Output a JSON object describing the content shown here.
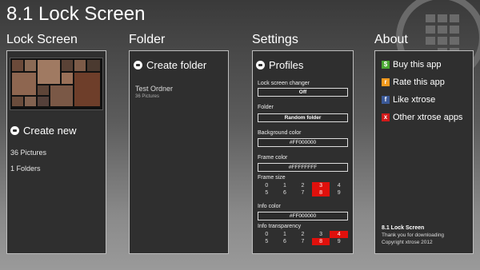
{
  "app": {
    "title": "8.1 Lock Screen"
  },
  "columns": {
    "lock": "Lock Screen",
    "folder": "Folder",
    "settings": "Settings",
    "about": "About"
  },
  "lock": {
    "create_label": "Create new",
    "pictures": "36 Pictures",
    "folders": "1 Folders"
  },
  "folder": {
    "create_label": "Create folder",
    "items": [
      {
        "name": "Test Ordner",
        "count": "36 Pictures"
      }
    ]
  },
  "settings": {
    "profiles_label": "Profiles",
    "changer_label": "Lock screen changer",
    "changer_value": "Off",
    "folder_label": "Folder",
    "folder_value": "Random folder",
    "bg_label": "Background color",
    "bg_value": "#FF000000",
    "frame_label": "Frame color",
    "frame_value": "#FFFFFFFF",
    "frame_size_label": "Frame size",
    "frame_size_options": [
      "0",
      "1",
      "2",
      "3",
      "4",
      "5",
      "6",
      "7",
      "8",
      "9"
    ],
    "frame_size_selected": [
      "3",
      "8"
    ],
    "info_label": "Info color",
    "info_value": "#FF000000",
    "transp_label": "Info transparency",
    "transp_options": [
      "0",
      "1",
      "2",
      "3",
      "4",
      "5",
      "6",
      "7",
      "8",
      "9"
    ],
    "transp_selected": [
      "4",
      "8"
    ]
  },
  "about": {
    "links": [
      {
        "label": "Buy this app",
        "icon": "dollar-icon",
        "glyph": "$",
        "color": "#4aa832"
      },
      {
        "label": "Rate this app",
        "icon": "rss-icon",
        "glyph": "r",
        "color": "#f39a1e"
      },
      {
        "label": "Like xtrose",
        "icon": "facebook-icon",
        "glyph": "f",
        "color": "#3b5998"
      },
      {
        "label": "Other xtrose apps",
        "icon": "xtrose-icon",
        "glyph": "x",
        "color": "#d21a1a"
      }
    ],
    "footer_title": "8.1 Lock Screen",
    "footer_thanks": "Thank you for downloading",
    "footer_copy": "Copyright xtrose 2012"
  },
  "colors": {
    "selected": "#e0100c",
    "panel": "#2f2f2f"
  }
}
